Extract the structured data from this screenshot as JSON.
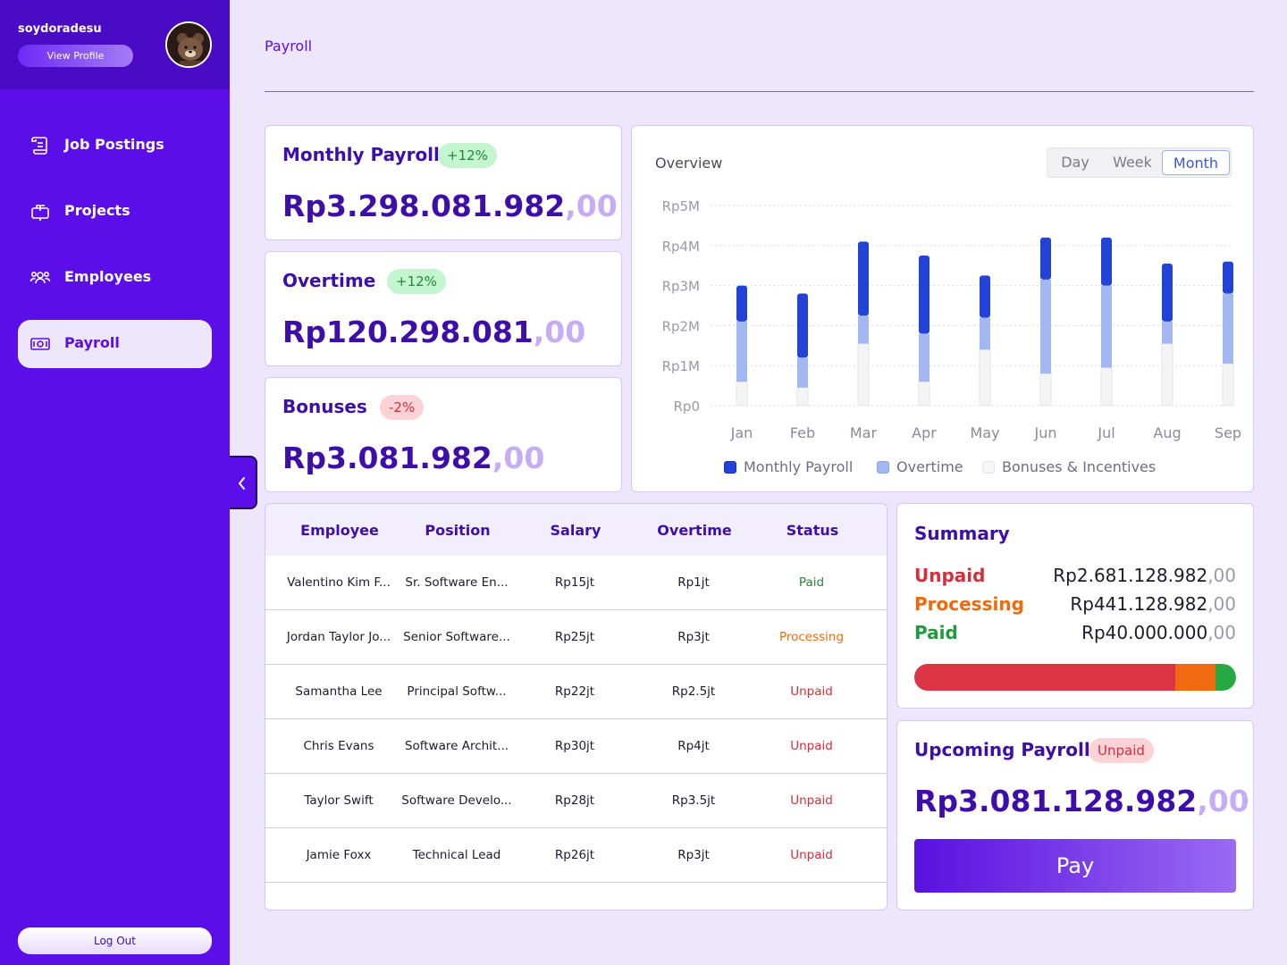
{
  "sidebar": {
    "username": "soydoradesu",
    "view_profile_label": "View Profile",
    "items": [
      {
        "label": "Job Postings",
        "icon": "job-postings-icon"
      },
      {
        "label": "Projects",
        "icon": "projects-icon"
      },
      {
        "label": "Employees",
        "icon": "employees-icon"
      },
      {
        "label": "Payroll",
        "icon": "payroll-icon",
        "active": true
      }
    ],
    "logout_label": "Log Out"
  },
  "header": {
    "title": "Payroll"
  },
  "stats": [
    {
      "title": "Monthly Payroll",
      "badge": "+12%",
      "badge_tone": "positive",
      "value": "Rp3.298.081.982",
      "decimals": ",00"
    },
    {
      "title": "Overtime",
      "badge": "+12%",
      "badge_tone": "positive",
      "value": "Rp120.298.081",
      "decimals": ",00"
    },
    {
      "title": "Bonuses",
      "badge": "-2%",
      "badge_tone": "negative",
      "value": "Rp3.081.982",
      "decimals": ",00"
    }
  ],
  "overview": {
    "label": "Overview",
    "range_options": [
      "Day",
      "Week",
      "Month"
    ],
    "selected_range": "Month"
  },
  "chart_data": {
    "type": "bar",
    "stacked": true,
    "categories": [
      "Jan",
      "Feb",
      "Mar",
      "Apr",
      "May",
      "Jun",
      "Jul",
      "Aug",
      "Sep"
    ],
    "y_tick_labels": [
      "Rp0",
      "Rp1M",
      "Rp2M",
      "Rp3M",
      "Rp4M",
      "Rp5M"
    ],
    "ylim": [
      0,
      5000000
    ],
    "grid": true,
    "legend_position": "bottom",
    "series": [
      {
        "name": "Bonuses & Incentives",
        "color": "#f4f4f6",
        "values": [
          600000,
          450000,
          1550000,
          600000,
          1400000,
          800000,
          950000,
          1550000,
          1050000
        ]
      },
      {
        "name": "Overtime",
        "color": "#a3b8f2",
        "values": [
          1500000,
          750000,
          700000,
          1200000,
          800000,
          2350000,
          2050000,
          550000,
          1750000
        ]
      },
      {
        "name": "Monthly Payroll",
        "color": "#2343d6",
        "values": [
          900000,
          1600000,
          1850000,
          1950000,
          1050000,
          1050000,
          1200000,
          1450000,
          800000
        ]
      }
    ]
  },
  "table": {
    "columns": [
      "Employee",
      "Position",
      "Salary",
      "Overtime",
      "Status"
    ],
    "rows": [
      {
        "employee": "Valentino Kim F...",
        "position": "Sr. Software En...",
        "salary": "Rp15jt",
        "overtime": "Rp1jt",
        "status": "Paid",
        "status_kind": "paid"
      },
      {
        "employee": "Jordan Taylor Jo...",
        "position": "Senior Software...",
        "salary": "Rp25jt",
        "overtime": "Rp3jt",
        "status": "Processing",
        "status_kind": "processing"
      },
      {
        "employee": "Samantha Lee",
        "position": "Principal Softw...",
        "salary": "Rp22jt",
        "overtime": "Rp2.5jt",
        "status": "Unpaid",
        "status_kind": "unpaid"
      },
      {
        "employee": "Chris Evans",
        "position": "Software Archit...",
        "salary": "Rp30jt",
        "overtime": "Rp4jt",
        "status": "Unpaid",
        "status_kind": "unpaid"
      },
      {
        "employee": "Taylor Swift",
        "position": "Software Develo...",
        "salary": "Rp28jt",
        "overtime": "Rp3.5jt",
        "status": "Unpaid",
        "status_kind": "unpaid"
      },
      {
        "employee": "Jamie Foxx",
        "position": "Technical Lead",
        "salary": "Rp26jt",
        "overtime": "Rp3jt",
        "status": "Unpaid",
        "status_kind": "unpaid"
      }
    ]
  },
  "summary": {
    "title": "Summary",
    "items": [
      {
        "label": "Unpaid",
        "value": "Rp2.681.128.982",
        "decimals": ",00",
        "color": "#d62e3c"
      },
      {
        "label": "Processing",
        "value": "Rp441.128.982",
        "decimals": ",00",
        "color": "#ef6a0c"
      },
      {
        "label": "Paid",
        "value": "Rp40.000.000",
        "decimals": ",00",
        "color": "#1f9a3d"
      }
    ],
    "progress_fractions": {
      "unpaid": 0.81,
      "processing": 0.125,
      "paid": 0.065
    }
  },
  "upcoming": {
    "title": "Upcoming Payroll",
    "badge": "Unpaid",
    "value": "Rp3.081.128.982",
    "decimals": ",00",
    "pay_label": "Pay"
  }
}
